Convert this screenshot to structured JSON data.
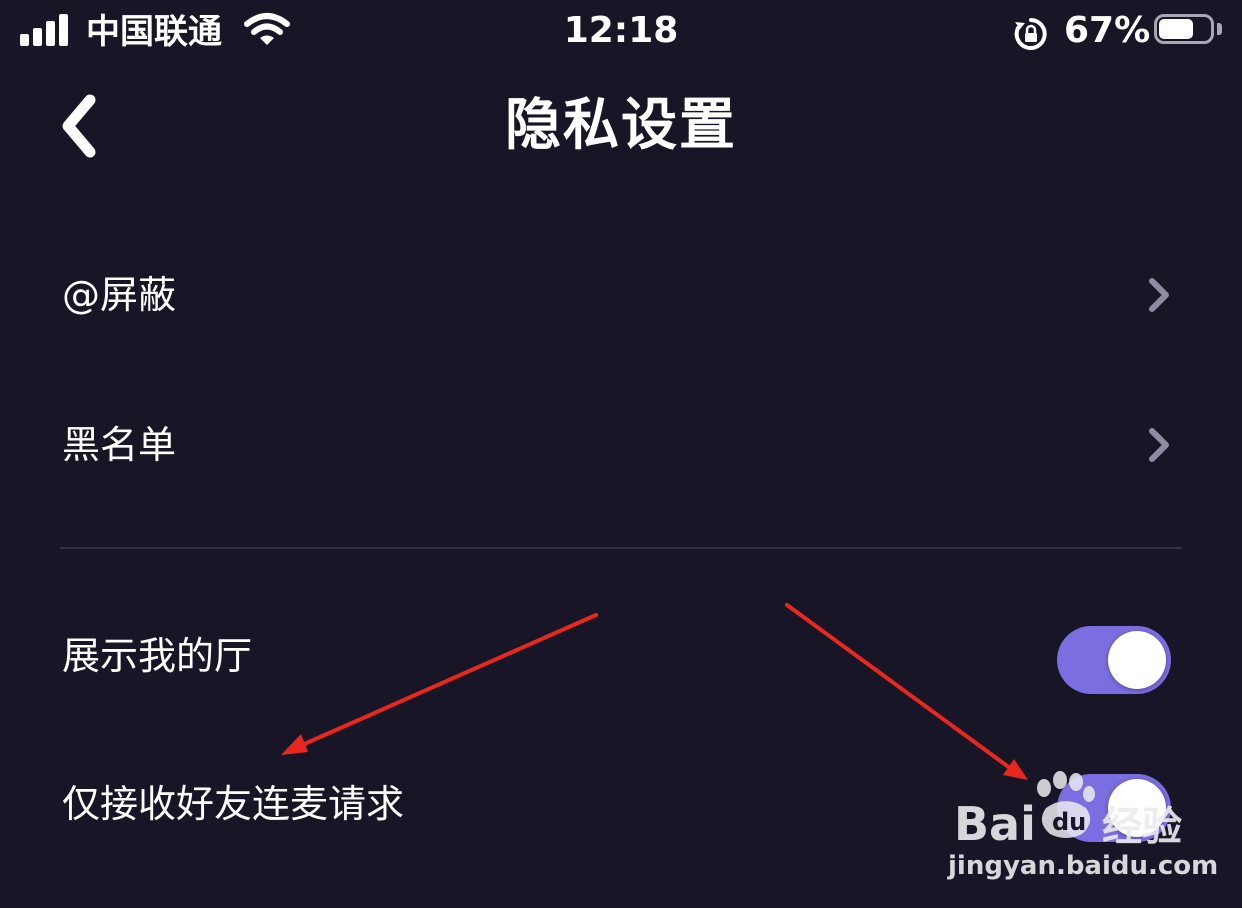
{
  "status_bar": {
    "carrier": "中国联通",
    "time": "12:18",
    "battery_percent": "67%",
    "battery_level": 0.67,
    "icons": [
      "signal-icon",
      "wifi-icon",
      "rotation-lock-icon",
      "battery-icon"
    ]
  },
  "nav": {
    "title": "隐私设置",
    "back_icon": "chevron-left-icon"
  },
  "settings": {
    "links": [
      {
        "label": "@屏蔽",
        "icon": "chevron-right-icon"
      },
      {
        "label": "黑名单",
        "icon": "chevron-right-icon"
      }
    ],
    "toggles": [
      {
        "label": "展示我的厅",
        "on": true
      },
      {
        "label": "仅接收好友连麦请求",
        "on": true
      }
    ]
  },
  "colors": {
    "background": "#181626",
    "toggle_on": "#7a6ee0",
    "chevron": "#8e8ca3",
    "divider": "#34323f",
    "annotation_arrow": "#e8281f"
  },
  "watermark": {
    "logo_text": "Baidu经验",
    "url": "jingyan.baidu.com"
  }
}
